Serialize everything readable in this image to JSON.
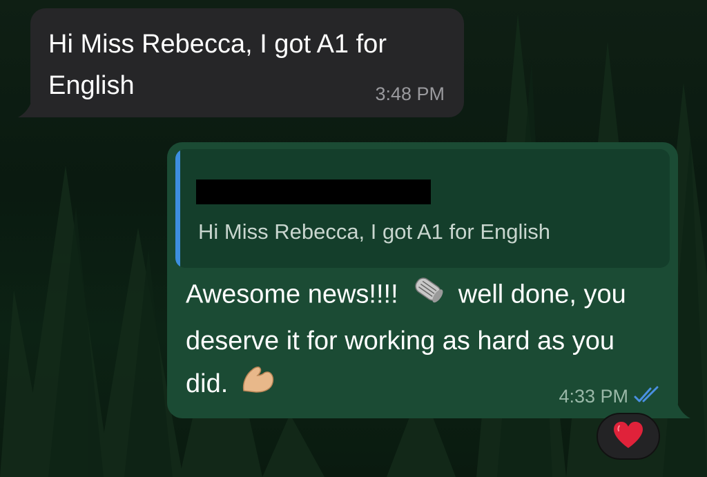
{
  "chat": {
    "incoming": {
      "text": "Hi Miss Rebecca, I got A1 for English",
      "time": "3:48 PM"
    },
    "outgoing": {
      "quote_text": "Hi Miss Rebecca, I got A1 for English",
      "text_part1": "Awesome news!!!!",
      "emoji1": "rolled-newspaper-emoji",
      "text_part2": "well done, you deserve it for working as hard as you did.",
      "emoji2": "flexed-biceps-emoji",
      "time": "4:33 PM",
      "status_icon": "double-check-icon",
      "status_color": "#4a90e2"
    },
    "reaction": {
      "icon": "red-heart-icon",
      "color": "#e0223a"
    }
  },
  "colors": {
    "incoming_bubble": "#262628",
    "outgoing_bubble": "#1b4b34",
    "quote_bar": "#3d8fe0"
  }
}
